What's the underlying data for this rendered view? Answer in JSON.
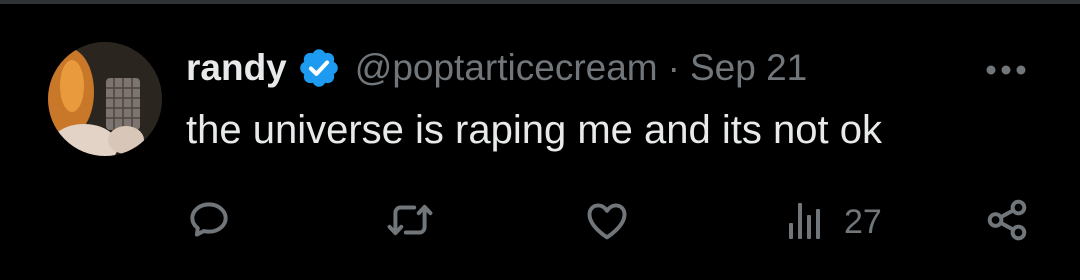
{
  "post": {
    "author": {
      "display_name": "randy",
      "handle": "@poptarticecream",
      "verified": true,
      "avatar": "avatar"
    },
    "separator": "·",
    "date": "Sep 21",
    "text": "the universe is raping me and its not ok",
    "actions": {
      "reply": {
        "icon": "reply-icon"
      },
      "repost": {
        "icon": "repost-icon"
      },
      "like": {
        "icon": "like-icon"
      },
      "views": {
        "icon": "views-icon",
        "count": "27"
      },
      "share": {
        "icon": "share-icon"
      }
    },
    "more": {
      "icon": "more-icon"
    }
  },
  "colors": {
    "background": "#000000",
    "primary_text": "#e7e9ea",
    "secondary_text": "#71767b",
    "verified_badge": "#1d9bf0",
    "divider": "#2f3336"
  }
}
